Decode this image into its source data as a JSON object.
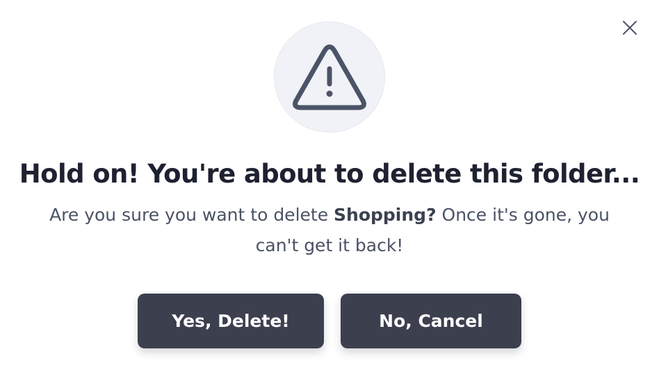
{
  "dialog": {
    "close_icon": "close-icon",
    "warning_icon": "warning-triangle-icon",
    "title": "Hold on! You're about to delete this folder...",
    "message_prefix": "Are you sure you want to delete ",
    "folder_name": "Shopping?",
    "message_suffix": " Once it's gone, you can't get it back!",
    "confirm_label": "Yes, Delete!",
    "cancel_label": "No, Cancel"
  },
  "colors": {
    "button_bg": "#3c3f4e",
    "icon_circle_bg": "#f1f2f7",
    "icon_stroke": "#4b5467",
    "title_color": "#1e2130",
    "message_color": "#4a5264"
  }
}
